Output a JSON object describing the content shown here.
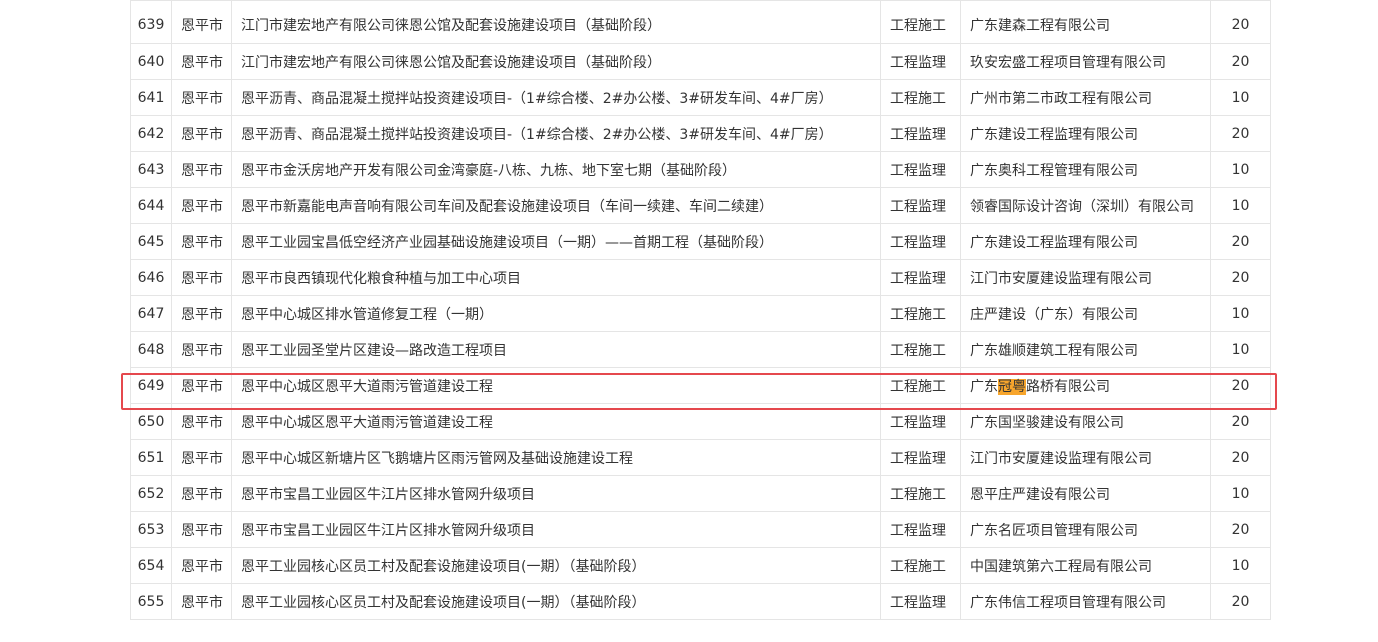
{
  "table": {
    "rows": [
      {
        "no": "639",
        "city": "恩平市",
        "project": "江门市建宏地产有限公司徕恩公馆及配套设施建设项目（基础阶段）",
        "type": "工程施工",
        "company": "广东建森工程有限公司",
        "score": "20"
      },
      {
        "no": "640",
        "city": "恩平市",
        "project": "江门市建宏地产有限公司徕恩公馆及配套设施建设项目（基础阶段）",
        "type": "工程监理",
        "company": "玖安宏盛工程项目管理有限公司",
        "score": "20"
      },
      {
        "no": "641",
        "city": "恩平市",
        "project": "恩平沥青、商品混凝土搅拌站投资建设项目-（1#综合楼、2#办公楼、3#研发车间、4#厂房）",
        "type": "工程施工",
        "company": "广州市第二市政工程有限公司",
        "score": "10"
      },
      {
        "no": "642",
        "city": "恩平市",
        "project": "恩平沥青、商品混凝土搅拌站投资建设项目-（1#综合楼、2#办公楼、3#研发车间、4#厂房）",
        "type": "工程监理",
        "company": "广东建设工程监理有限公司",
        "score": "20"
      },
      {
        "no": "643",
        "city": "恩平市",
        "project": "恩平市金沃房地产开发有限公司金湾豪庭-八栋、九栋、地下室七期（基础阶段）",
        "type": "工程监理",
        "company": "广东奥科工程管理有限公司",
        "score": "10"
      },
      {
        "no": "644",
        "city": "恩平市",
        "project": "恩平市新嘉能电声音响有限公司车间及配套设施建设项目（车间一续建、车间二续建）",
        "type": "工程监理",
        "company": "领睿国际设计咨询（深圳）有限公司",
        "score": "10"
      },
      {
        "no": "645",
        "city": "恩平市",
        "project": "恩平工业园宝昌低空经济产业园基础设施建设项目（一期）——首期工程（基础阶段）",
        "type": "工程监理",
        "company": "广东建设工程监理有限公司",
        "score": "20"
      },
      {
        "no": "646",
        "city": "恩平市",
        "project": "恩平市良西镇现代化粮食种植与加工中心项目",
        "type": "工程监理",
        "company": "江门市安厦建设监理有限公司",
        "score": "20"
      },
      {
        "no": "647",
        "city": "恩平市",
        "project": "恩平中心城区排水管道修复工程（一期）",
        "type": "工程施工",
        "company": "庄严建设（广东）有限公司",
        "score": "10"
      },
      {
        "no": "648",
        "city": "恩平市",
        "project": "恩平工业园圣堂片区建设—路改造工程项目",
        "type": "工程施工",
        "company": "广东雄顺建筑工程有限公司",
        "score": "10"
      },
      {
        "no": "649",
        "city": "恩平市",
        "project": "恩平中心城区恩平大道雨污管道建设工程",
        "type": "工程施工",
        "company_pre": "广东",
        "company_hl": "冠粤",
        "company_post": "路桥有限公司",
        "score": "20"
      },
      {
        "no": "650",
        "city": "恩平市",
        "project": "恩平中心城区恩平大道雨污管道建设工程",
        "type": "工程监理",
        "company": "广东国坚骏建设有限公司",
        "score": "20"
      },
      {
        "no": "651",
        "city": "恩平市",
        "project": "恩平中心城区新塘片区飞鹅塘片区雨污管网及基础设施建设工程",
        "type": "工程监理",
        "company": "江门市安厦建设监理有限公司",
        "score": "20"
      },
      {
        "no": "652",
        "city": "恩平市",
        "project": "恩平市宝昌工业园区牛江片区排水管网升级项目",
        "type": "工程施工",
        "company": "恩平庄严建设有限公司",
        "score": "10"
      },
      {
        "no": "653",
        "city": "恩平市",
        "project": "恩平市宝昌工业园区牛江片区排水管网升级项目",
        "type": "工程监理",
        "company": "广东名匠项目管理有限公司",
        "score": "20"
      },
      {
        "no": "654",
        "city": "恩平市",
        "project": "恩平工业园核心区员工村及配套设施建设项目(一期）（基础阶段）",
        "type": "工程施工",
        "company": "中国建筑第六工程局有限公司",
        "score": "10"
      },
      {
        "no": "655",
        "city": "恩平市",
        "project": "恩平工业园核心区员工村及配套设施建设项目(一期）（基础阶段）",
        "type": "工程监理",
        "company": "广东伟信工程项目管理有限公司",
        "score": "20"
      }
    ]
  },
  "colors": {
    "highlight_box": "#e5484d",
    "search_highlight": "#f7a52c",
    "border": "#e5e5e5"
  }
}
